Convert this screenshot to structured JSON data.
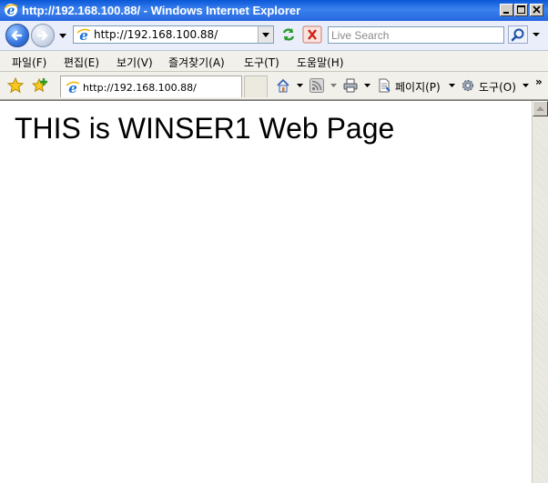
{
  "window": {
    "title": "http://192.168.100.88/ - Windows Internet Explorer"
  },
  "address_bar": {
    "url": "http://192.168.100.88/"
  },
  "search": {
    "placeholder": "Live Search"
  },
  "menu": {
    "items": [
      "파일(F)",
      "편집(E)",
      "보기(V)",
      "즐겨찾기(A)",
      "도구(T)",
      "도움말(H)"
    ]
  },
  "tab": {
    "label": "http://192.168.100.88/"
  },
  "commands": {
    "page_label": "페이지(P)",
    "tools_label": "도구(O)",
    "overflow": "»"
  },
  "page": {
    "heading": "THIS is WINSER1 Web Page"
  },
  "colors": {
    "titlebar": "#2566df",
    "toolbar_bg": "#e9eefa",
    "menubar_bg": "#f1f0ea"
  },
  "icons": [
    "ie-logo-icon",
    "back-arrow-icon",
    "forward-arrow-icon",
    "refresh-icon",
    "stop-icon",
    "search-icon",
    "favorites-star-icon",
    "add-favorite-icon",
    "home-icon",
    "rss-feed-icon",
    "print-icon",
    "page-icon",
    "tools-gear-icon"
  ]
}
